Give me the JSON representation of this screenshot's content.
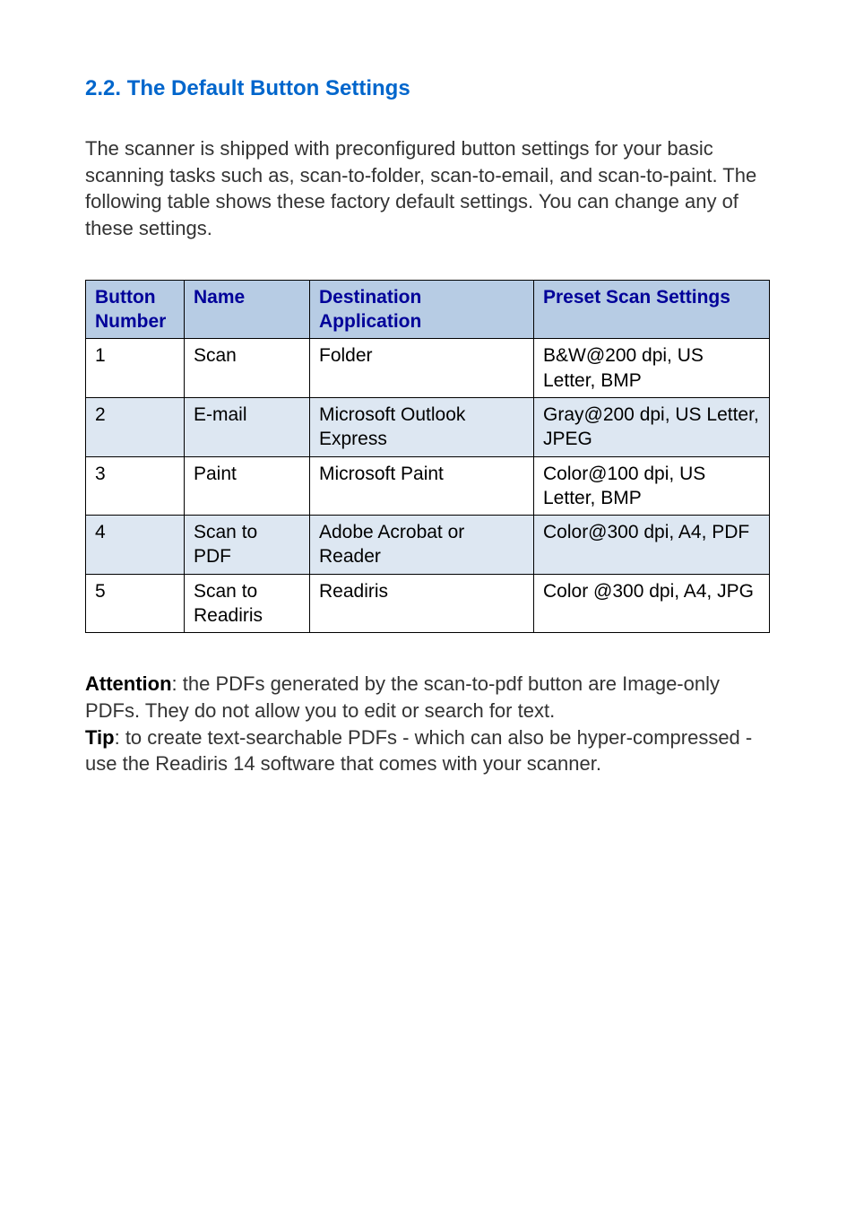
{
  "heading": "2.2.  The Default Button Settings",
  "intro": "The scanner is shipped with preconfigured button settings for your basic scanning tasks such as, scan-to-folder, scan-to-email, and scan-to-paint. The following table shows these factory default settings.   You can change any of these settings.",
  "table": {
    "headers": {
      "number": "Button Number",
      "name": "Name",
      "destination": "Destination Application",
      "preset": "Preset Scan Settings"
    },
    "rows": [
      {
        "number": "1",
        "name": "Scan",
        "destination": "Folder",
        "preset": "B&W@200 dpi, US Letter, BMP"
      },
      {
        "number": "2",
        "name": "E-mail",
        "destination": "Microsoft Outlook Express",
        "preset": "Gray@200 dpi, US Letter, JPEG"
      },
      {
        "number": "3",
        "name": "Paint",
        "destination": "Microsoft Paint",
        "preset": "Color@100 dpi, US Letter, BMP"
      },
      {
        "number": "4",
        "name": "Scan to PDF",
        "destination": "Adobe Acrobat or Reader",
        "preset": "Color@300 dpi, A4, PDF"
      },
      {
        "number": "5",
        "name": "Scan to Readiris",
        "destination": "Readiris",
        "preset": "Color @300 dpi, A4, JPG"
      }
    ]
  },
  "notes": {
    "attention_label": "Attention",
    "attention_text": ": the PDFs generated by the scan-to-pdf button are Image-only PDFs. They do not allow you to edit or search for text.",
    "tip_label": "Tip",
    "tip_text": ": to create text-searchable PDFs - which can also be hyper-compressed - use the Readiris 14 software that comes with your scanner."
  }
}
